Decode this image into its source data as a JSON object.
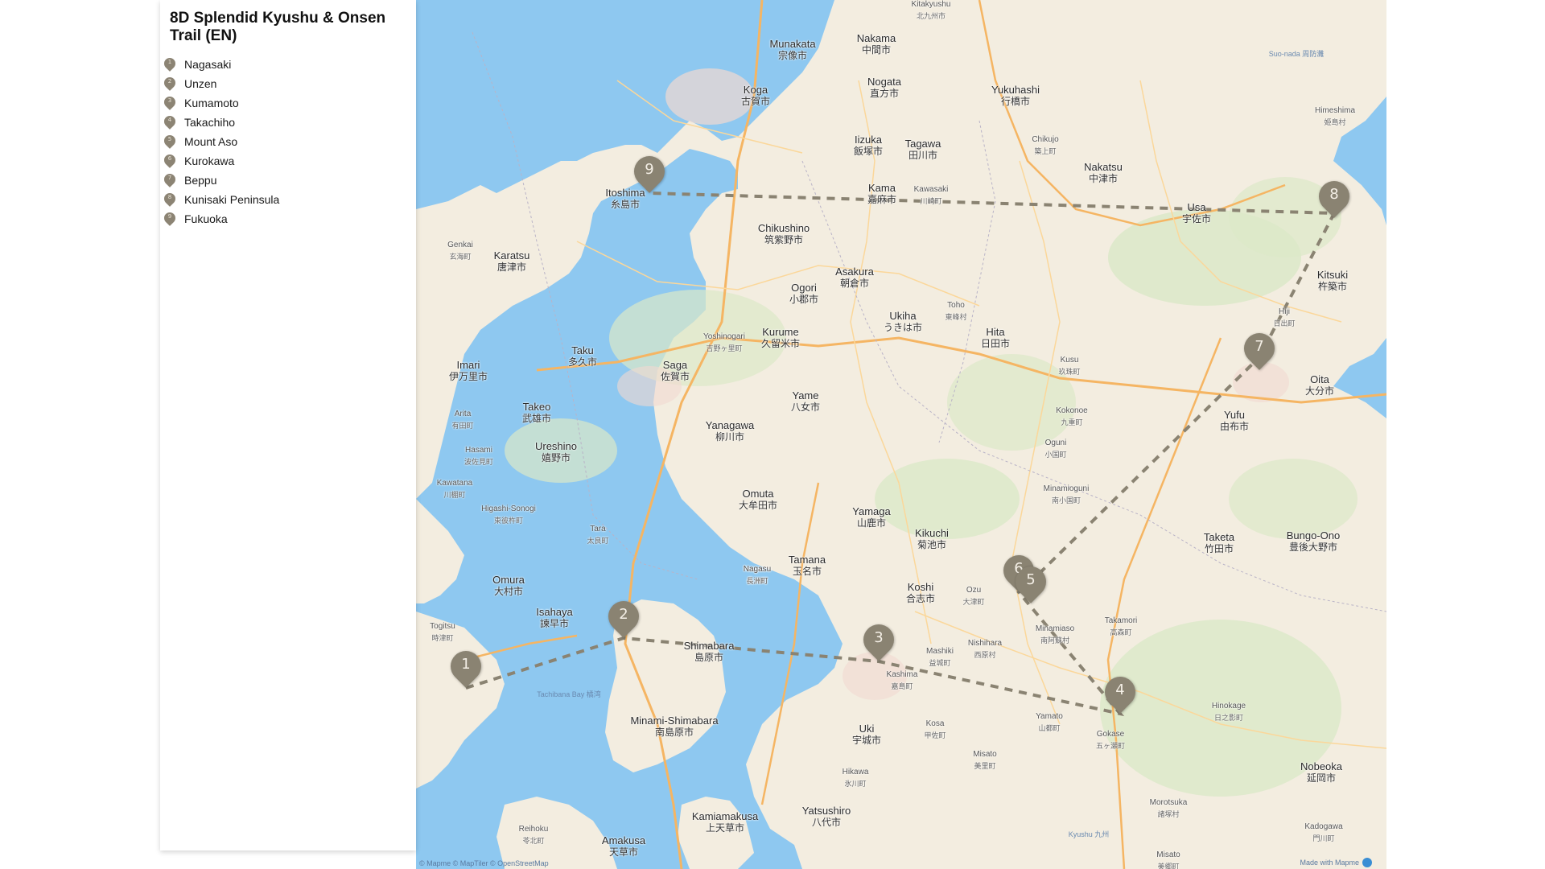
{
  "map_title": "8D Splendid Kyushu & Onsen Trail (EN)",
  "stops": [
    {
      "num": "1",
      "name": "Nagasaki"
    },
    {
      "num": "2",
      "name": "Unzen"
    },
    {
      "num": "3",
      "name": "Kumamoto"
    },
    {
      "num": "4",
      "name": "Takachiho"
    },
    {
      "num": "5",
      "name": "Mount Aso"
    },
    {
      "num": "6",
      "name": "Kurokawa"
    },
    {
      "num": "7",
      "name": "Beppu"
    },
    {
      "num": "8",
      "name": "Kunisaki Peninsula"
    },
    {
      "num": "9",
      "name": "Fukuoka"
    }
  ],
  "markers": [
    {
      "num": "1"
    },
    {
      "num": "2"
    },
    {
      "num": "3"
    },
    {
      "num": "4"
    },
    {
      "num": "5"
    },
    {
      "num": "6"
    },
    {
      "num": "7"
    },
    {
      "num": "8"
    },
    {
      "num": "9"
    }
  ],
  "cities": [
    {
      "en": "Munakata",
      "jp": "宗像市"
    },
    {
      "en": "Nakama",
      "jp": "中間市"
    },
    {
      "en": "Koga",
      "jp": "古賀市"
    },
    {
      "en": "Nogata",
      "jp": "直方市"
    },
    {
      "en": "Yukuhashi",
      "jp": "行橋市"
    },
    {
      "en": "Iizuka",
      "jp": "飯塚市"
    },
    {
      "en": "Tagawa",
      "jp": "田川市"
    },
    {
      "en": "Itoshima",
      "jp": "糸島市"
    },
    {
      "en": "Kama",
      "jp": "嘉麻市"
    },
    {
      "en": "Nakatsu",
      "jp": "中津市"
    },
    {
      "en": "Usa",
      "jp": "宇佐市"
    },
    {
      "en": "Chikushino",
      "jp": "筑紫野市"
    },
    {
      "en": "Karatsu",
      "jp": "唐津市"
    },
    {
      "en": "Asakura",
      "jp": "朝倉市"
    },
    {
      "en": "Ogori",
      "jp": "小郡市"
    },
    {
      "en": "Kitsuki",
      "jp": "杵築市"
    },
    {
      "en": "Ukiha",
      "jp": "うきは市"
    },
    {
      "en": "Kurume",
      "jp": "久留米市"
    },
    {
      "en": "Hita",
      "jp": "日田市"
    },
    {
      "en": "Taku",
      "jp": "多久市"
    },
    {
      "en": "Saga",
      "jp": "佐賀市"
    },
    {
      "en": "Imari",
      "jp": "伊万里市"
    },
    {
      "en": "Oita",
      "jp": "大分市"
    },
    {
      "en": "Yame",
      "jp": "八女市"
    },
    {
      "en": "Takeo",
      "jp": "武雄市"
    },
    {
      "en": "Yanagawa",
      "jp": "柳川市"
    },
    {
      "en": "Yufu",
      "jp": "由布市"
    },
    {
      "en": "Ureshino",
      "jp": "嬉野市"
    },
    {
      "en": "Omuta",
      "jp": "大牟田市"
    },
    {
      "en": "Yamaga",
      "jp": "山鹿市"
    },
    {
      "en": "Kikuchi",
      "jp": "菊池市"
    },
    {
      "en": "Taketa",
      "jp": "竹田市"
    },
    {
      "en": "Bungo-Ono",
      "jp": "豊後大野市"
    },
    {
      "en": "Tamana",
      "jp": "玉名市"
    },
    {
      "en": "Omura",
      "jp": "大村市"
    },
    {
      "en": "Koshi",
      "jp": "合志市"
    },
    {
      "en": "Isahaya",
      "jp": "諫早市"
    },
    {
      "en": "Shimabara",
      "jp": "島原市"
    },
    {
      "en": "Minami-Shimabara",
      "jp": "南島原市"
    },
    {
      "en": "Uki",
      "jp": "宇城市"
    },
    {
      "en": "Nobeoka",
      "jp": "延岡市"
    },
    {
      "en": "Kamiamakusa",
      "jp": "上天草市"
    },
    {
      "en": "Yatsushiro",
      "jp": "八代市"
    },
    {
      "en": "Amakusa",
      "jp": "天草市"
    }
  ],
  "small_places": [
    {
      "en": "Kitakyushu",
      "jp": "北九州市"
    },
    {
      "en": "Genkai",
      "jp": "玄海町"
    },
    {
      "en": "Arita",
      "jp": "有田町"
    },
    {
      "en": "Hasami",
      "jp": "波佐見町"
    },
    {
      "en": "Kawatana",
      "jp": "川棚町"
    },
    {
      "en": "Higashi-Sonogi",
      "jp": "東彼杵町"
    },
    {
      "en": "Tara",
      "jp": "太良町"
    },
    {
      "en": "Togitsu",
      "jp": "時津町"
    },
    {
      "en": "Yoshinogari",
      "jp": "吉野ヶ里町"
    },
    {
      "en": "Kusu",
      "jp": "玖珠町"
    },
    {
      "en": "Kokonoe",
      "jp": "九重町"
    },
    {
      "en": "Oguni",
      "jp": "小国町"
    },
    {
      "en": "Minamioguni",
      "jp": "南小国町"
    },
    {
      "en": "Nagasu",
      "jp": "長洲町"
    },
    {
      "en": "Ozu",
      "jp": "大津町"
    },
    {
      "en": "Minamiaso",
      "jp": "南阿蘇村"
    },
    {
      "en": "Takamori",
      "jp": "高森町"
    },
    {
      "en": "Mashiki",
      "jp": "益城町"
    },
    {
      "en": "Nishihara",
      "jp": "西原村"
    },
    {
      "en": "Kashima",
      "jp": "嘉島町"
    },
    {
      "en": "Yamato",
      "jp": "山都町"
    },
    {
      "en": "Kosa",
      "jp": "甲佐町"
    },
    {
      "en": "Misato",
      "jp": "美里町"
    },
    {
      "en": "Gokase",
      "jp": "五ヶ瀬町"
    },
    {
      "en": "Hinokage",
      "jp": "日之影町"
    },
    {
      "en": "Hikawa",
      "jp": "氷川町"
    },
    {
      "en": "Reihoku",
      "jp": "苓北町"
    },
    {
      "en": "Morotsuka",
      "jp": "諸塚村"
    },
    {
      "en": "Kadogawa",
      "jp": "門川町"
    },
    {
      "en": "Misato",
      "jp": "美郷町"
    },
    {
      "en": "Chikujo",
      "jp": "築上町"
    },
    {
      "en": "Kawasaki",
      "jp": "川崎町"
    },
    {
      "en": "Toho",
      "jp": "東峰村"
    },
    {
      "en": "Hiji",
      "jp": "日出町"
    },
    {
      "en": "Nagasu",
      "jp": "長洲町"
    },
    {
      "en": "Himeshima",
      "jp": "姫島村"
    }
  ],
  "water_labels": [
    "Tachibana Bay 橘湾",
    "Suo-nada 周防灘",
    "Kyushu 九州"
  ],
  "attribution": "© Mapme © MapTiler © OpenStreetMap",
  "made_with": "Made with Mapme",
  "colors": {
    "marker": "#8a8372",
    "route": "#8a8372",
    "water": "#8ec8f0",
    "land": "#f3ede0"
  }
}
